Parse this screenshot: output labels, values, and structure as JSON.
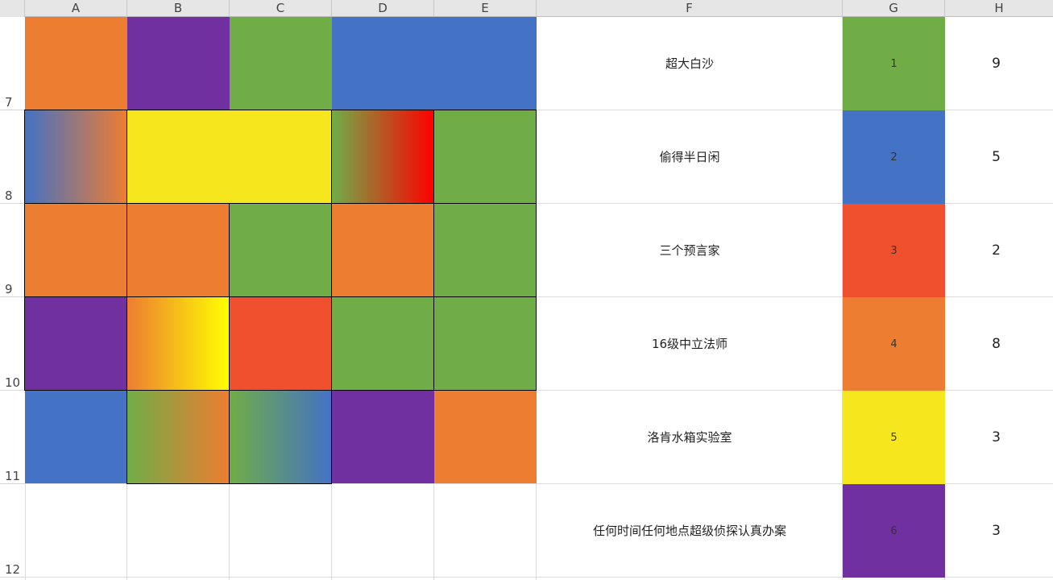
{
  "colors": {
    "orange": "#ed7d31",
    "purple": "#7030a0",
    "green": "#70ad47",
    "blue": "#4472c4",
    "yellow": "#f5e61e",
    "red": "#f0502d",
    "bright_red": "#ff0000",
    "bright_yellow": "#ffff00"
  },
  "columns": [
    "A",
    "B",
    "C",
    "D",
    "E",
    "F",
    "G",
    "H"
  ],
  "rows": [
    "7",
    "8",
    "9",
    "10",
    "11",
    "12"
  ],
  "list": [
    {
      "name": "超大白沙",
      "index": "1",
      "count": "9"
    },
    {
      "name": "偷得半日闲",
      "index": "2",
      "count": "5"
    },
    {
      "name": "三个预言家",
      "index": "3",
      "count": "2"
    },
    {
      "name": "16级中立法师",
      "index": "4",
      "count": "8"
    },
    {
      "name": "洛肯水箱实验室",
      "index": "5",
      "count": "3"
    },
    {
      "name": "任何时间任何地点超级侦探认真办案",
      "index": "6",
      "count": "3"
    }
  ]
}
